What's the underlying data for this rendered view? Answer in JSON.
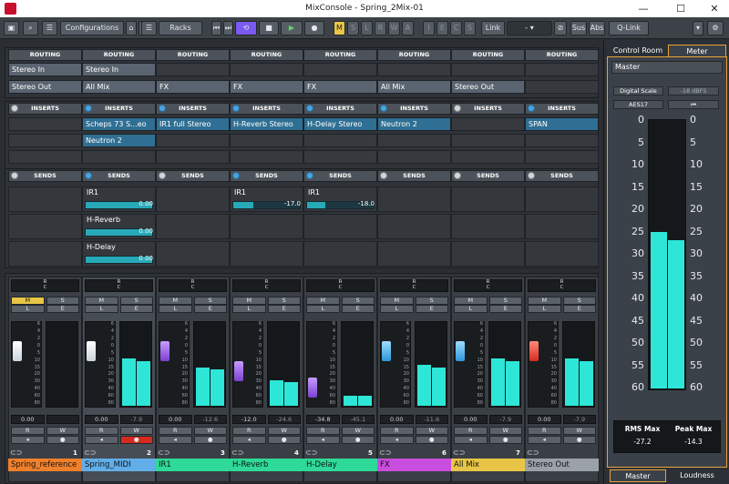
{
  "window": {
    "title": "MixConsole - Spring_2Mix-01",
    "minimize": "—",
    "maximize": "☐",
    "close": "✕"
  },
  "toolbar": {
    "configurations": "Configurations",
    "racks": "Racks",
    "m": "M",
    "s": "S",
    "l": "L",
    "r": "R",
    "w": "W",
    "a": "A",
    "i": "I",
    "e": "E",
    "c": "C",
    "s2": "S",
    "link": "Link",
    "sus": "Sus",
    "abs": "Abs",
    "qlink": "Q-Link"
  },
  "routing": {
    "header": "ROUTING",
    "inputs": [
      "Stereo In",
      "Stereo In",
      "",
      "",
      "",
      "",
      "",
      ""
    ],
    "outputs": [
      "Stereo Out",
      "All Mix",
      "FX",
      "FX",
      "FX",
      "All Mix",
      "Stereo Out",
      ""
    ]
  },
  "inserts": {
    "header": "INSERTS",
    "slot1": [
      "",
      "Scheps 73 S...eo",
      "IR1 full Stereo",
      "H-Reverb Stereo",
      "H-Delay Stereo",
      "Neutron 2",
      "",
      "SPAN"
    ],
    "slot2": [
      "",
      "Neutron 2",
      "",
      "",
      "",
      "",
      "",
      ""
    ]
  },
  "sends": {
    "header": "SENDS",
    "ch2": [
      {
        "name": "IR1",
        "value": "0.00",
        "level": 1.0
      },
      {
        "name": "H-Reverb",
        "value": "0.00",
        "level": 1.0
      },
      {
        "name": "H-Delay",
        "value": "0.00",
        "level": 1.0
      }
    ],
    "ch4": {
      "name": "IR1",
      "value": "-17.0",
      "level": 0.3
    },
    "ch5": {
      "name": "IR1",
      "value": "-18.0",
      "level": 0.28
    }
  },
  "channels": [
    {
      "name": "Spring_reference",
      "num": "1",
      "color": "#f0802c",
      "fader": "0.00",
      "meter": "",
      "handle": "white",
      "level": 0.0,
      "fader_pos": 0.3,
      "selected": false
    },
    {
      "name": "Spring_MIDI",
      "num": "2",
      "color": "#61aee8",
      "fader": "0.00",
      "meter": "-7.9",
      "handle": "white",
      "level": 0.56,
      "fader_pos": 0.3,
      "selected": true
    },
    {
      "name": "IR1",
      "num": "3",
      "color": "#2fd999",
      "fader": "0.00",
      "meter": "-12.6",
      "handle": "purple",
      "level": 0.45,
      "fader_pos": 0.3,
      "selected": false
    },
    {
      "name": "H-Reverb",
      "num": "4",
      "color": "#2fd999",
      "fader": "-12.0",
      "meter": "-24.6",
      "handle": "purple",
      "level": 0.3,
      "fader_pos": 0.6,
      "selected": false
    },
    {
      "name": "H-Delay",
      "num": "5",
      "color": "#2fd999",
      "fader": "-34.8",
      "meter": "-45.1",
      "handle": "purple",
      "level": 0.12,
      "fader_pos": 0.85,
      "selected": false
    },
    {
      "name": "FX",
      "num": "6",
      "color": "#c94dde",
      "fader": "0.00",
      "meter": "-11.6",
      "handle": "blue",
      "level": 0.48,
      "fader_pos": 0.3,
      "selected": false
    },
    {
      "name": "All Mix",
      "num": "7",
      "color": "#e8c547",
      "fader": "0.00",
      "meter": "-7.9",
      "handle": "blue",
      "level": 0.56,
      "fader_pos": 0.3,
      "selected": false
    },
    {
      "name": "Stereo Out",
      "num": "",
      "color": "#9aa1a8",
      "fader": "0.00",
      "meter": "-7.9",
      "handle": "red",
      "level": 0.56,
      "fader_pos": 0.3,
      "selected": false
    }
  ],
  "strip": {
    "pan_r": "R",
    "pan_c": "C",
    "mute": "M",
    "solo": "S",
    "listen": "L",
    "edit": "E",
    "read": "R",
    "write": "W"
  },
  "meter_scale": [
    "6",
    "4",
    "2",
    "0",
    "5",
    "10",
    "15",
    "20",
    "30",
    "40",
    "60",
    "80"
  ],
  "right": {
    "tab_control_room": "Control Room",
    "tab_meter": "Meter",
    "master_label": "Master",
    "digital_scale": "Digital Scale",
    "dbfs": "-18 dBFS",
    "aes17": "AES17",
    "reset": "⏮",
    "scale": [
      "0",
      "5",
      "10",
      "15",
      "20",
      "25",
      "30",
      "35",
      "40",
      "45",
      "50",
      "55",
      "60"
    ],
    "rms_label": "RMS Max",
    "peak_label": "Peak Max",
    "rms_value": "-27.2",
    "peak_value": "-14.3",
    "rms_level": 0.58,
    "peak_level": 0.55,
    "tab_master": "Master",
    "tab_loudness": "Loudness"
  }
}
